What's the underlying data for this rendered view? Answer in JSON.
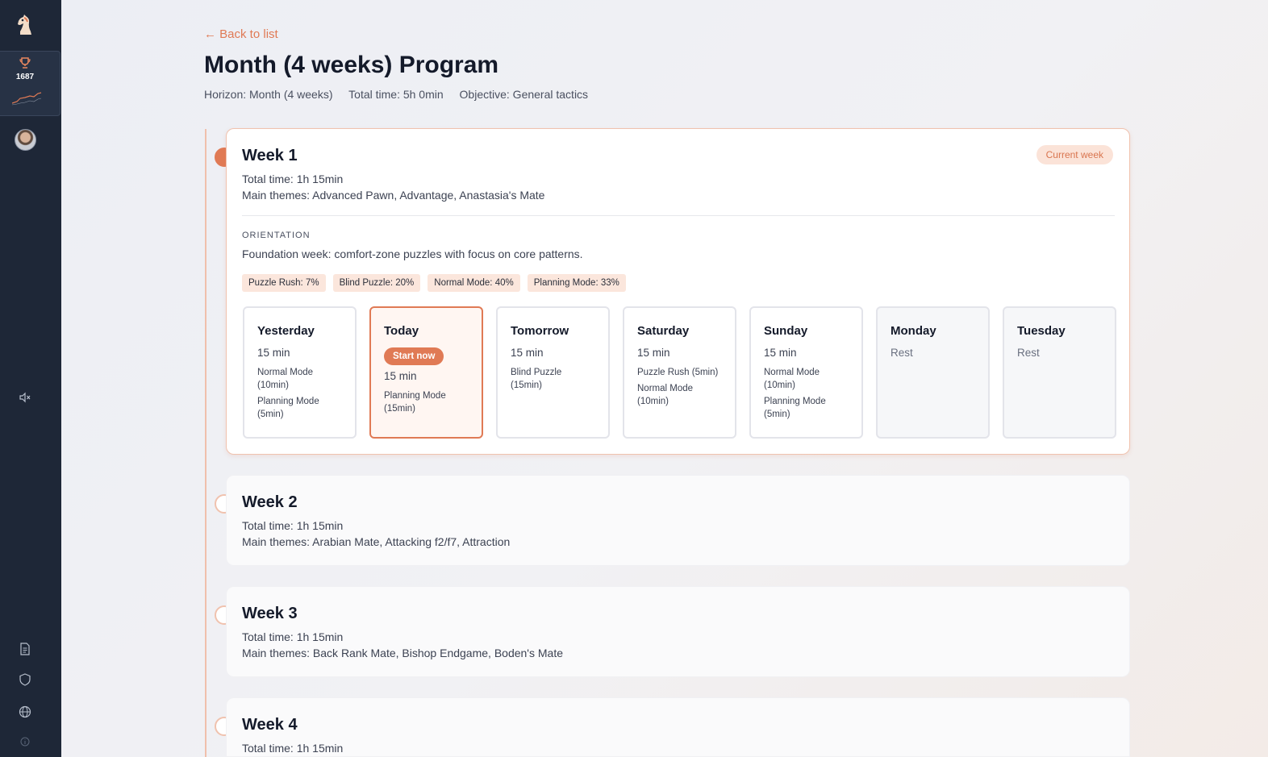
{
  "sidebar": {
    "rating": "1687"
  },
  "header": {
    "back_label": "← Back to list",
    "title": "Month (4 weeks) Program",
    "meta": {
      "horizon": "Horizon: Month (4 weeks)",
      "total_time": "Total time: 5h 0min",
      "objective": "Objective: General tactics"
    }
  },
  "weeks": [
    {
      "title": "Week 1",
      "total_time": "Total time: 1h 15min",
      "themes": "Main themes: Advanced Pawn, Advantage, Anastasia's Mate",
      "badge": "Current week",
      "orientation_label": "ORIENTATION",
      "orientation_text": "Foundation week: comfort-zone puzzles with focus on core patterns.",
      "tags": [
        "Puzzle Rush: 7%",
        "Blind Puzzle: 20%",
        "Normal Mode: 40%",
        "Planning Mode: 33%"
      ],
      "days": [
        {
          "name": "Yesterday",
          "duration": "15 min",
          "activities": [
            "Normal Mode (10min)",
            "Planning Mode (5min)"
          ]
        },
        {
          "name": "Today",
          "button": "Start now",
          "duration": "15 min",
          "activities": [
            "Planning Mode (15min)"
          ]
        },
        {
          "name": "Tomorrow",
          "duration": "15 min",
          "activities": [
            "Blind Puzzle (15min)"
          ]
        },
        {
          "name": "Saturday",
          "duration": "15 min",
          "activities": [
            "Puzzle Rush (5min)",
            "Normal Mode (10min)"
          ]
        },
        {
          "name": "Sunday",
          "duration": "15 min",
          "activities": [
            "Normal Mode (10min)",
            "Planning Mode (5min)"
          ]
        },
        {
          "name": "Monday",
          "duration": "Rest",
          "activities": []
        },
        {
          "name": "Tuesday",
          "duration": "Rest",
          "activities": []
        }
      ]
    },
    {
      "title": "Week 2",
      "total_time": "Total time: 1h 15min",
      "themes": "Main themes: Arabian Mate, Attacking f2/f7, Attraction"
    },
    {
      "title": "Week 3",
      "total_time": "Total time: 1h 15min",
      "themes": "Main themes: Back Rank Mate, Bishop Endgame, Boden's Mate"
    },
    {
      "title": "Week 4",
      "total_time": "Total time: 1h 15min"
    }
  ]
}
